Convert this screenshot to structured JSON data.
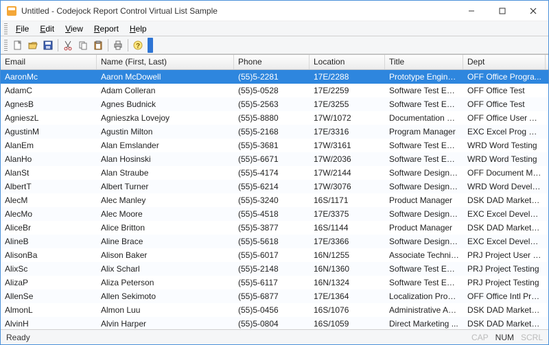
{
  "window": {
    "title": "Untitled - Codejock Report Control Virtual List Sample"
  },
  "menu": {
    "file": "File",
    "edit": "Edit",
    "view": "View",
    "report": "Report",
    "help": "Help"
  },
  "toolbar": {
    "new": "New",
    "open": "Open",
    "save": "Save",
    "cut": "Cut",
    "copy": "Copy",
    "paste": "Paste",
    "print": "Print",
    "help": "Help"
  },
  "columns": {
    "email": "Email",
    "name": "Name (First, Last)",
    "phone": "Phone",
    "location": "Location",
    "title": "Title",
    "dept": "Dept"
  },
  "rows": [
    {
      "email": "AaronMc",
      "name": "Aaron McDowell",
      "phone": "(55)5-2281",
      "location": "17E/2288",
      "title": "Prototype Engineer",
      "dept": "OFF Office Progra...",
      "selected": true
    },
    {
      "email": "AdamC",
      "name": "Adam Colleran",
      "phone": "(55)5-0528",
      "location": "17E/2259",
      "title": "Software Test Engi...",
      "dept": "OFF Office Test"
    },
    {
      "email": "AgnesB",
      "name": "Agnes Budnick",
      "phone": "(55)5-2563",
      "location": "17E/3255",
      "title": "Software Test Engi...",
      "dept": "OFF Office Test"
    },
    {
      "email": "AgnieszL",
      "name": "Agnieszka Lovejoy",
      "phone": "(55)5-8880",
      "location": "17W/1072",
      "title": "Documentation M...",
      "dept": "OFF Office User As..."
    },
    {
      "email": "AgustinM",
      "name": "Agustin Milton",
      "phone": "(55)5-2168",
      "location": "17E/3316",
      "title": "Program Manager",
      "dept": "EXC Excel Prog Mg..."
    },
    {
      "email": "AlanEm",
      "name": "Alan Emslander",
      "phone": "(55)5-3681",
      "location": "17W/3161",
      "title": "Software Test Engi...",
      "dept": "WRD Word Testing"
    },
    {
      "email": "AlanHo",
      "name": "Alan Hosinski",
      "phone": "(55)5-6671",
      "location": "17W/2036",
      "title": "Software Test Engi...",
      "dept": "WRD Word Testing"
    },
    {
      "email": "AlanSt",
      "name": "Alan Straube",
      "phone": "(55)5-4174",
      "location": "17W/2144",
      "title": "Software Design En...",
      "dept": "OFF Document Mg..."
    },
    {
      "email": "AlbertT",
      "name": "Albert Turner",
      "phone": "(55)5-6214",
      "location": "17W/3076",
      "title": "Software Design En...",
      "dept": "WRD Word Develo..."
    },
    {
      "email": "AlecM",
      "name": "Alec Manley",
      "phone": "(55)5-3240",
      "location": "16S/1171",
      "title": "Product Manager",
      "dept": "DSK DAD Marketing"
    },
    {
      "email": "AlecMo",
      "name": "Alec Moore",
      "phone": "(55)5-4518",
      "location": "17E/3375",
      "title": "Software Design En...",
      "dept": "EXC Excel Develop..."
    },
    {
      "email": "AliceBr",
      "name": "Alice Britton",
      "phone": "(55)5-3877",
      "location": "16S/1144",
      "title": "Product Manager",
      "dept": "DSK DAD Marketing"
    },
    {
      "email": "AlineB",
      "name": "Aline Brace",
      "phone": "(55)5-5618",
      "location": "17E/3366",
      "title": "Software Design En...",
      "dept": "EXC Excel Develop..."
    },
    {
      "email": "AlisonBa",
      "name": "Alison Baker",
      "phone": "(55)5-6017",
      "location": "16N/1255",
      "title": "Associate Technica...",
      "dept": "PRJ Project User Ed"
    },
    {
      "email": "AlixSc",
      "name": "Alix Scharl",
      "phone": "(55)5-2148",
      "location": "16N/1360",
      "title": "Software Test Engi...",
      "dept": "PRJ Project Testing"
    },
    {
      "email": "AlizaP",
      "name": "Aliza Peterson",
      "phone": "(55)5-6117",
      "location": "16N/1324",
      "title": "Software Test Engi...",
      "dept": "PRJ Project Testing"
    },
    {
      "email": "AllenSe",
      "name": "Allen Sekimoto",
      "phone": "(55)5-6877",
      "location": "17E/1364",
      "title": "Localization Progra...",
      "dept": "OFF Office Intl Pro..."
    },
    {
      "email": "AlmonL",
      "name": "Almon Luu",
      "phone": "(55)5-0456",
      "location": "16S/1076",
      "title": "Administrative Assi...",
      "dept": "DSK DAD Marketing"
    },
    {
      "email": "AlvinH",
      "name": "Alvin Harper",
      "phone": "(55)5-0804",
      "location": "16S/1059",
      "title": "Direct Marketing ...",
      "dept": "DSK DAD Marketing"
    }
  ],
  "status": {
    "ready": "Ready",
    "cap": "CAP",
    "num": "NUM",
    "scrl": "SCRL"
  }
}
